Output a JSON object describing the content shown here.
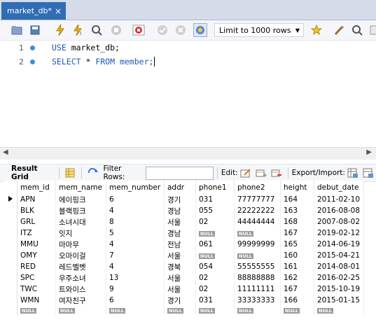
{
  "tab": {
    "title": "market_db*",
    "close": "×"
  },
  "toolbar": {
    "limit_label": "Limit to 1000 rows"
  },
  "editor": {
    "lines": [
      {
        "num": "1",
        "kw": "USE",
        "rest": " market_db;"
      },
      {
        "num": "2",
        "kw": "SELECT",
        "rest": " * ",
        "kw2": "FROM",
        "rest2": " member;"
      }
    ]
  },
  "gridbar": {
    "result_grid": "Result Grid",
    "filter_rows": "Filter Rows:",
    "edit": "Edit:",
    "export_import": "Export/Import:"
  },
  "table": {
    "columns": [
      "mem_id",
      "mem_name",
      "mem_number",
      "addr",
      "phone1",
      "phone2",
      "height",
      "debut_date"
    ],
    "rows": [
      [
        "APN",
        "에이핑크",
        "6",
        "경기",
        "031",
        "77777777",
        "164",
        "2011-02-10"
      ],
      [
        "BLK",
        "블랙핑크",
        "4",
        "경남",
        "055",
        "22222222",
        "163",
        "2016-08-08"
      ],
      [
        "GRL",
        "소녀시대",
        "8",
        "서울",
        "02",
        "44444444",
        "168",
        "2007-08-02"
      ],
      [
        "ITZ",
        "잇지",
        "5",
        "경남",
        "NULL",
        "NULL",
        "167",
        "2019-02-12"
      ],
      [
        "MMU",
        "마마무",
        "4",
        "전남",
        "061",
        "99999999",
        "165",
        "2014-06-19"
      ],
      [
        "OMY",
        "오마이걸",
        "7",
        "서울",
        "NULL",
        "NULL",
        "160",
        "2015-04-21"
      ],
      [
        "RED",
        "레드벨벳",
        "4",
        "경북",
        "054",
        "55555555",
        "161",
        "2014-08-01"
      ],
      [
        "SPC",
        "우주소녀",
        "13",
        "서울",
        "02",
        "88888888",
        "162",
        "2016-02-25"
      ],
      [
        "TWC",
        "트와이스",
        "9",
        "서울",
        "02",
        "11111111",
        "167",
        "2015-10-19"
      ],
      [
        "WMN",
        "여자친구",
        "6",
        "경기",
        "031",
        "33333333",
        "166",
        "2015-01-15"
      ],
      [
        "NULL",
        "NULL",
        "NULL",
        "NULL",
        "NULL",
        "NULL",
        "NULL",
        "NULL"
      ]
    ]
  },
  "colors": {
    "tab_active": "#2f6db5",
    "keyword": "#1f59b3",
    "line_marker": "#3c8be0",
    "null_badge": "#9a9a9a"
  }
}
